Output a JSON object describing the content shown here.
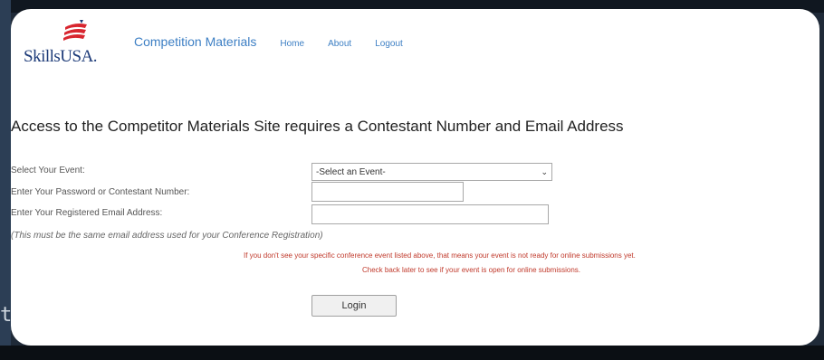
{
  "logo": {
    "text": "SkillsUSA.",
    "colors": [
      "#d8262f",
      "#1c3a78"
    ]
  },
  "nav": {
    "brand": "Competition Materials",
    "links": [
      "Home",
      "About",
      "Logout"
    ]
  },
  "headline": "Access to the Competitor Materials Site requires a Contestant Number and Email Address",
  "form": {
    "event_label": "Select Your Event:",
    "event_value": "-Select an Event-",
    "password_label": "Enter Your Password or Contestant Number:",
    "password_value": "",
    "email_label": "Enter Your Registered Email Address:",
    "email_value": "",
    "note": "(This must be the same email address used for your Conference Registration)",
    "warning_line1": "If you don't see your specific conference event listed above, that means your event is not ready for online submissions yet.",
    "warning_line2": "Check back later to see if your event is open for online submissions.",
    "login_label": "Login"
  },
  "stray_char": "t",
  "colors": {
    "link": "#3d7fc4",
    "warning": "#c0392b",
    "background": "#1f2a38"
  }
}
